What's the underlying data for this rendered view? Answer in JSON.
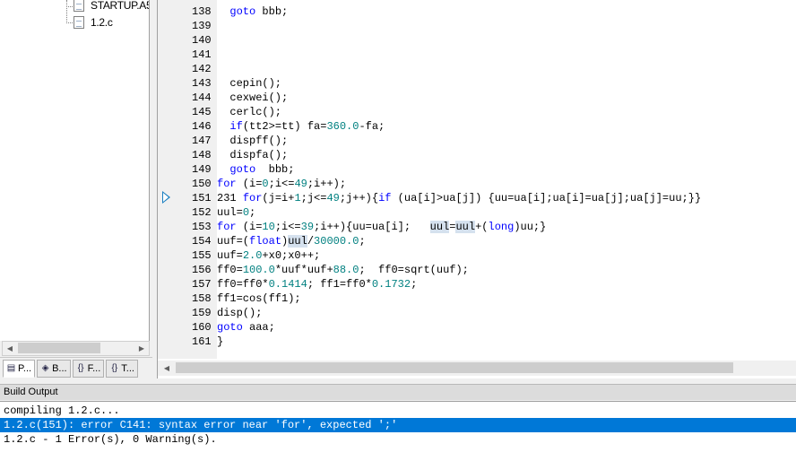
{
  "project_tree": {
    "items": [
      {
        "label": "STARTUP.A5"
      },
      {
        "label": "1.2.c"
      }
    ]
  },
  "panel_tabs": [
    {
      "label": "P...",
      "icon": "project-icon"
    },
    {
      "label": "B...",
      "icon": "books-icon"
    },
    {
      "label": "F...",
      "icon": "functions-icon"
    },
    {
      "label": "T...",
      "icon": "templates-icon"
    }
  ],
  "editor": {
    "line_numbers": [
      "138",
      "139",
      "140",
      "141",
      "142",
      "143",
      "144",
      "145",
      "146",
      "147",
      "148",
      "149",
      "150",
      "151",
      "152",
      "153",
      "154",
      "155",
      "156",
      "157",
      "158",
      "159",
      "160",
      "161"
    ],
    "highlighted_line": "151"
  },
  "build_output": {
    "title": "Build Output",
    "lines": [
      "compiling 1.2.c...",
      "1.2.c(151): error C141: syntax error near 'for', expected ';'",
      "1.2.c - 1 Error(s), 0 Warning(s)."
    ]
  }
}
